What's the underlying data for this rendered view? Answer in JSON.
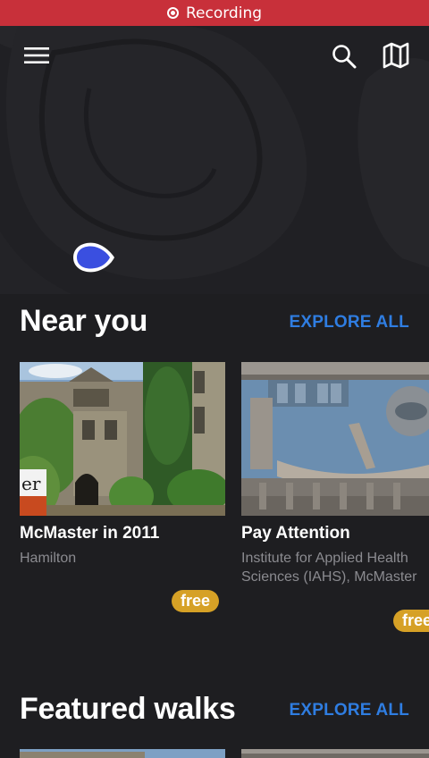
{
  "status_bar": {
    "recording_label": "Recording"
  },
  "toolbar": {
    "menu_icon": "menu-icon",
    "search_icon": "search-icon",
    "map_icon": "map-icon"
  },
  "near_you": {
    "title": "Near you",
    "explore_label": "EXPLORE ALL",
    "cards": [
      {
        "title": "McMaster in 2011",
        "subtitle": "Hamilton",
        "badge": "free",
        "sign_text": "er"
      },
      {
        "title": "Pay Attention",
        "subtitle": "Institute for Applied Health Sciences (IAHS), McMaster",
        "badge": "free"
      }
    ]
  },
  "featured_walks": {
    "title": "Featured walks",
    "explore_label": "EXPLORE ALL"
  },
  "colors": {
    "accent": "#2f7de1",
    "badge": "#d6a126",
    "recording": "#c8303a",
    "background": "#1e1e21"
  }
}
